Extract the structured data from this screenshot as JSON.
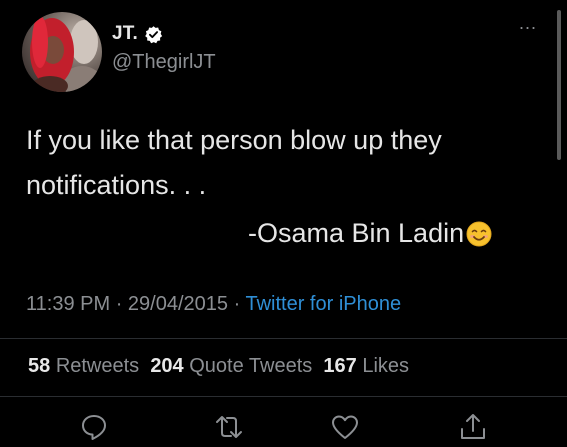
{
  "tweet": {
    "author": {
      "display_name": "JT.",
      "handle": "@ThegirlJT",
      "verified_icon": "verified-badge-icon"
    },
    "more_label": "...",
    "text_line_1": "If you like that person blow up they",
    "text_line_2": "notifications. . .",
    "signature": "-Osama Bin Ladin",
    "signature_emoji": "smiling-face-emoji",
    "time": "11:39 PM",
    "date": "29/04/2015",
    "source": "Twitter for iPhone",
    "separator": "·"
  },
  "stats": {
    "retweets_count": "58",
    "retweets_label": "Retweets",
    "quotes_count": "204",
    "quotes_label": "Quote Tweets",
    "likes_count": "167",
    "likes_label": "Likes"
  },
  "actions": {
    "reply_icon": "reply-icon",
    "retweet_icon": "retweet-icon",
    "like_icon": "heart-icon",
    "share_icon": "share-icon"
  },
  "colors": {
    "background": "#000000",
    "link": "#2f8fd6",
    "secondary_text": "#8c8f93",
    "verified": "#ffffff"
  }
}
